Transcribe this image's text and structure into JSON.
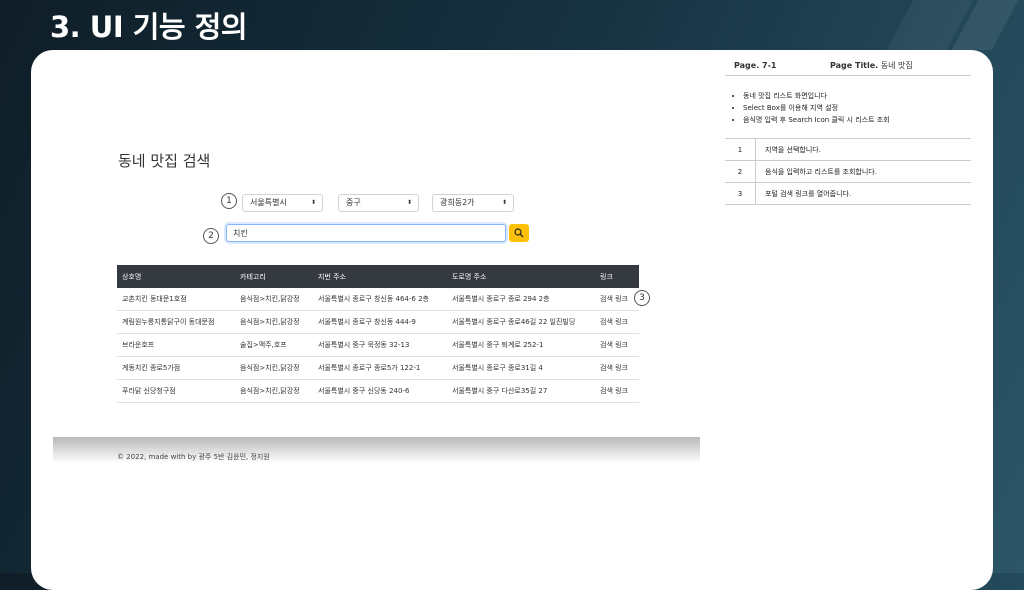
{
  "slide": {
    "title": "3. UI 기능 정의"
  },
  "page": {
    "heading": "동네 맛집 검색",
    "selects": [
      {
        "value": "서울특별시",
        "marker": "1"
      },
      {
        "value": "중구"
      },
      {
        "value": "광희동2가"
      }
    ],
    "search": {
      "value": "치킨",
      "marker": "2",
      "icon": "search-icon"
    },
    "results_marker": "3",
    "table": {
      "headers": [
        "상호명",
        "카테고리",
        "지번 주소",
        "도로명 주소",
        "링크"
      ],
      "rows": [
        [
          "교촌치킨 동대문1호점",
          "음식점>치킨,닭강정",
          "서울특별시 종로구 창신동 464-6 2층",
          "서울특별시 종로구 종로 294 2층",
          "검색 링크"
        ],
        [
          "계림원누룽지통닭구이 동대문점",
          "음식점>치킨,닭강정",
          "서울특별시 종로구 창신동 444-9",
          "서울특별시 종로구 종로46길 22 일진빌딩",
          "검색 링크"
        ],
        [
          "브라운호프",
          "술집>맥주,호프",
          "서울특별시 중구 묵정동 32-13",
          "서울특별시 중구 퇴계로 252-1",
          "검색 링크"
        ],
        [
          "계동치킨 종로5가점",
          "음식점>치킨,닭강정",
          "서울특별시 종로구 종로5가 122-1",
          "서울특별시 종로구 종로31길 4",
          "검색 링크"
        ],
        [
          "푸라닭 신당청구점",
          "음식점>치킨,닭강정",
          "서울특별시 중구 신당동 240-6",
          "서울특별시 중구 다산로35길 27",
          "검색 링크"
        ]
      ]
    },
    "footer": "© 2022, made with by 광주 5반 김윤민, 정지원"
  },
  "spec": {
    "page_label": "Page. 7-1",
    "title_label": "Page Title.",
    "title_value": "동네 맛집",
    "bullets": [
      "동네 맛집 리스트 화면입니다",
      "Select Box를 이용해 지역 설정",
      "음식명 입력 후 Search Icon 클릭 시 리스트 조회"
    ],
    "items": [
      {
        "num": "1",
        "desc": "지역을 선택합니다."
      },
      {
        "num": "2",
        "desc": "음식을 입력하고 리스트를 조회합니다."
      },
      {
        "num": "3",
        "desc": "포털 검색 링크를 열어줍니다."
      }
    ]
  }
}
